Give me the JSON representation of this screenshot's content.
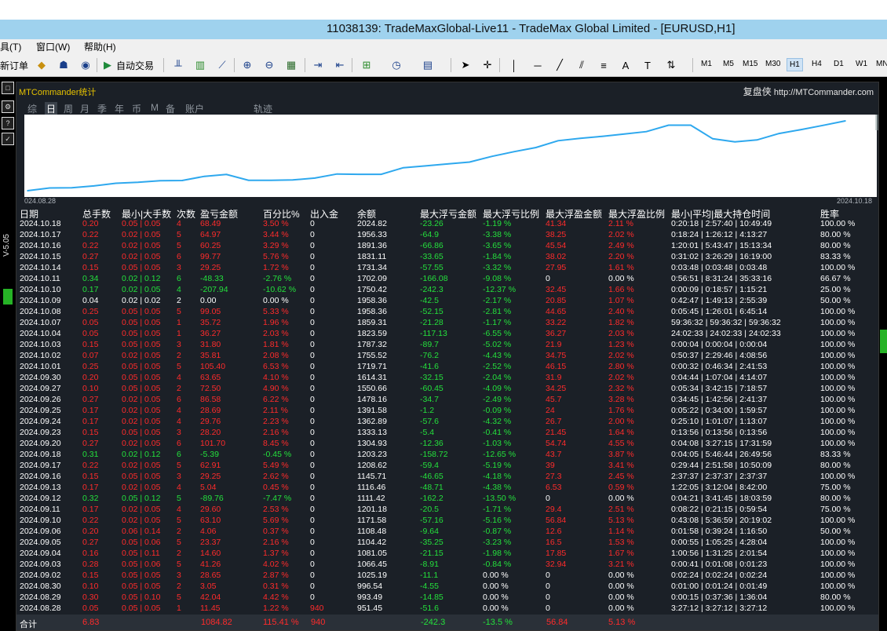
{
  "window": {
    "title": "11038139: TradeMaxGlobal-Live11 - TradeMax Global Limited - [EURUSD,H1]"
  },
  "menu": {
    "items": [
      "具(T)",
      "窗口(W)",
      "帮助(H)"
    ]
  },
  "toolbar": {
    "new_order": "新订单",
    "auto_trade": "自动交易",
    "timeframes": [
      "M1",
      "M5",
      "M15",
      "M30",
      "H1",
      "H4",
      "D1",
      "W1",
      "MN"
    ],
    "selected_timeframe": "H1"
  },
  "side": {
    "label": "V-5.05"
  },
  "panel": {
    "title": "MTCommander统计",
    "site_cn": "复盘侠",
    "site_url": "http://MTCommander.com",
    "tabs": [
      "综",
      "日",
      "周",
      "月",
      "季",
      "年",
      "币",
      "M",
      "备",
      "账户",
      "轨迹"
    ],
    "active_tab": "日",
    "chart_start": "024.08.28",
    "chart_end": "2024.10.18"
  },
  "chart_data": {
    "type": "line",
    "color": "#2ea8ee",
    "x": [
      "2024.08.28",
      "2024.08.29",
      "2024.08.30",
      "2024.09.02",
      "2024.09.03",
      "2024.09.04",
      "2024.09.05",
      "2024.09.06",
      "2024.09.09",
      "2024.09.10",
      "2024.09.11",
      "2024.09.12",
      "2024.09.13",
      "2024.09.16",
      "2024.09.17",
      "2024.09.18",
      "2024.09.19",
      "2024.09.20",
      "2024.09.23",
      "2024.09.24",
      "2024.09.25",
      "2024.09.26",
      "2024.09.27",
      "2024.09.30",
      "2024.10.01",
      "2024.10.02",
      "2024.10.03",
      "2024.10.04",
      "2024.10.07",
      "2024.10.08",
      "2024.10.09",
      "2024.10.10",
      "2024.10.11",
      "2024.10.14",
      "2024.10.15",
      "2024.10.16",
      "2024.10.17",
      "2024.10.18"
    ],
    "y": [
      951.45,
      993.49,
      996.54,
      1025.19,
      1066.45,
      1081.05,
      1104.42,
      1108.48,
      1171.58,
      1201.18,
      1111.42,
      1111.42,
      1116.46,
      1145.71,
      1208.62,
      1203.23,
      1203.23,
      1304.93,
      1333.13,
      1362.89,
      1391.58,
      1478.16,
      1550.66,
      1614.31,
      1719.71,
      1755.52,
      1787.32,
      1823.59,
      1859.31,
      1958.36,
      1958.36,
      1750.42,
      1702.09,
      1731.34,
      1831.11,
      1891.36,
      1956.33,
      2024.82
    ]
  },
  "table": {
    "headers": [
      "日期",
      "总手数",
      "最小|大手数",
      "次数",
      "盈亏金额",
      "百分比%",
      "出入金",
      "余额",
      "最大浮亏金额",
      "最大浮亏比例",
      "最大浮盈金额",
      "最大浮盈比例",
      "最小|平均|最大持仓时间",
      "胜率"
    ],
    "rows": [
      [
        "2024.10.18",
        "0.20",
        "0.05 | 0.05",
        "4",
        "68.49",
        "3.50 %",
        "0",
        "2024.82",
        "-23.26",
        "-1.19 %",
        "41.34",
        "2.11 %",
        "0:20:18 | 2:57:40 | 10:49:49",
        "100.00 %"
      ],
      [
        "2024.10.17",
        "0.22",
        "0.02 | 0.05",
        "5",
        "64.97",
        "3.44 %",
        "0",
        "1956.33",
        "-64.9",
        "-3.38 %",
        "38.25",
        "2.02 %",
        "0:18:24 | 1:26:12 | 4:13:27",
        "80.00 %"
      ],
      [
        "2024.10.16",
        "0.22",
        "0.02 | 0.05",
        "5",
        "60.25",
        "3.29 %",
        "0",
        "1891.36",
        "-66.86",
        "-3.65 %",
        "45.54",
        "2.49 %",
        "1:20:01 | 5:43:47 | 15:13:34",
        "80.00 %"
      ],
      [
        "2024.10.15",
        "0.27",
        "0.02 | 0.05",
        "6",
        "99.77",
        "5.76 %",
        "0",
        "1831.11",
        "-33.65",
        "-1.84 %",
        "38.02",
        "2.20 %",
        "0:31:02 | 3:26:29 | 16:19:00",
        "83.33 %"
      ],
      [
        "2024.10.14",
        "0.15",
        "0.05 | 0.05",
        "3",
        "29.25",
        "1.72 %",
        "0",
        "1731.34",
        "-57.55",
        "-3.32 %",
        "27.95",
        "1.61 %",
        "0:03:48 | 0:03:48 | 0:03:48",
        "100.00 %"
      ],
      [
        "2024.10.11",
        "0.34",
        "0.02 | 0.12",
        "6",
        "-48.33",
        "-2.76 %",
        "0",
        "1702.09",
        "-166.08",
        "-9.08 %",
        "0",
        "0.00 %",
        "0:56:51 | 8:31:24 | 35:33:16",
        "66.67 %"
      ],
      [
        "2024.10.10",
        "0.17",
        "0.02 | 0.05",
        "4",
        "-207.94",
        "-10.62 %",
        "0",
        "1750.42",
        "-242.3",
        "-12.37 %",
        "32.45",
        "1.66 %",
        "0:00:09 | 0:18:57 | 1:15:21",
        "25.00 %"
      ],
      [
        "2024.10.09",
        "0.04",
        "0.02 | 0.02",
        "2",
        "0.00",
        "0.00 %",
        "0",
        "1958.36",
        "-42.5",
        "-2.17 %",
        "20.85",
        "1.07 %",
        "0:42:47 | 1:49:13 | 2:55:39",
        "50.00 %"
      ],
      [
        "2024.10.08",
        "0.25",
        "0.05 | 0.05",
        "5",
        "99.05",
        "5.33 %",
        "0",
        "1958.36",
        "-52.15",
        "-2.81 %",
        "44.65",
        "2.40 %",
        "0:05:45 | 1:26:01 | 6:45:14",
        "100.00 %"
      ],
      [
        "2024.10.07",
        "0.05",
        "0.05 | 0.05",
        "1",
        "35.72",
        "1.96 %",
        "0",
        "1859.31",
        "-21.28",
        "-1.17 %",
        "33.22",
        "1.82 %",
        "59:36:32 | 59:36:32 | 59:36:32",
        "100.00 %"
      ],
      [
        "2024.10.04",
        "0.05",
        "0.05 | 0.05",
        "1",
        "36.27",
        "2.03 %",
        "0",
        "1823.59",
        "-117.13",
        "-6.55 %",
        "36.27",
        "2.03 %",
        "24:02:33 | 24:02:33 | 24:02:33",
        "100.00 %"
      ],
      [
        "2024.10.03",
        "0.15",
        "0.05 | 0.05",
        "3",
        "31.80",
        "1.81 %",
        "0",
        "1787.32",
        "-89.7",
        "-5.02 %",
        "21.9",
        "1.23 %",
        "0:00:04 | 0:00:04 | 0:00:04",
        "100.00 %"
      ],
      [
        "2024.10.02",
        "0.07",
        "0.02 | 0.05",
        "2",
        "35.81",
        "2.08 %",
        "0",
        "1755.52",
        "-76.2",
        "-4.43 %",
        "34.75",
        "2.02 %",
        "0:50:37 | 2:29:46 | 4:08:56",
        "100.00 %"
      ],
      [
        "2024.10.01",
        "0.25",
        "0.05 | 0.05",
        "5",
        "105.40",
        "6.53 %",
        "0",
        "1719.71",
        "-41.6",
        "-2.52 %",
        "46.15",
        "2.80 %",
        "0:00:32 | 0:46:34 | 2:41:53",
        "100.00 %"
      ],
      [
        "2024.09.30",
        "0.20",
        "0.05 | 0.05",
        "4",
        "63.65",
        "4.10 %",
        "0",
        "1614.31",
        "-32.15",
        "-2.04 %",
        "31.9",
        "2.02 %",
        "0:04:44 | 1:07:04 | 4:14:07",
        "100.00 %"
      ],
      [
        "2024.09.27",
        "0.10",
        "0.05 | 0.05",
        "2",
        "72.50",
        "4.90 %",
        "0",
        "1550.66",
        "-60.45",
        "-4.09 %",
        "34.25",
        "2.32 %",
        "0:05:34 | 3:42:15 | 7:18:57",
        "100.00 %"
      ],
      [
        "2024.09.26",
        "0.27",
        "0.02 | 0.05",
        "6",
        "86.58",
        "6.22 %",
        "0",
        "1478.16",
        "-34.7",
        "-2.49 %",
        "45.7",
        "3.28 %",
        "0:34:45 | 1:42:56 | 2:41:37",
        "100.00 %"
      ],
      [
        "2024.09.25",
        "0.17",
        "0.02 | 0.05",
        "4",
        "28.69",
        "2.11 %",
        "0",
        "1391.58",
        "-1.2",
        "-0.09 %",
        "24",
        "1.76 %",
        "0:05:22 | 0:34:00 | 1:59:57",
        "100.00 %"
      ],
      [
        "2024.09.24",
        "0.17",
        "0.02 | 0.05",
        "4",
        "29.76",
        "2.23 %",
        "0",
        "1362.89",
        "-57.6",
        "-4.32 %",
        "26.7",
        "2.00 %",
        "0:25:10 | 1:01:07 | 1:13:07",
        "100.00 %"
      ],
      [
        "2024.09.23",
        "0.15",
        "0.05 | 0.05",
        "3",
        "28.20",
        "2.16 %",
        "0",
        "1333.13",
        "-5.4",
        "-0.41 %",
        "21.45",
        "1.64 %",
        "0:13:56 | 0:13:56 | 0:13:56",
        "100.00 %"
      ],
      [
        "2024.09.20",
        "0.27",
        "0.02 | 0.05",
        "6",
        "101.70",
        "8.45 %",
        "0",
        "1304.93",
        "-12.36",
        "-1.03 %",
        "54.74",
        "4.55 %",
        "0:04:08 | 3:27:15 | 17:31:59",
        "100.00 %"
      ],
      [
        "2024.09.18",
        "0.31",
        "0.02 | 0.12",
        "6",
        "-5.39",
        "-0.45 %",
        "0",
        "1203.23",
        "-158.72",
        "-12.65 %",
        "43.7",
        "3.87 %",
        "0:04:05 | 5:46:44 | 26:49:56",
        "83.33 %"
      ],
      [
        "2024.09.17",
        "0.22",
        "0.02 | 0.05",
        "5",
        "62.91",
        "5.49 %",
        "0",
        "1208.62",
        "-59.4",
        "-5.19 %",
        "39",
        "3.41 %",
        "0:29:44 | 2:51:58 | 10:50:09",
        "80.00 %"
      ],
      [
        "2024.09.16",
        "0.15",
        "0.05 | 0.05",
        "3",
        "29.25",
        "2.62 %",
        "0",
        "1145.71",
        "-46.65",
        "-4.18 %",
        "27.3",
        "2.45 %",
        "2:37:37 | 2:37:37 | 2:37:37",
        "100.00 %"
      ],
      [
        "2024.09.13",
        "0.17",
        "0.02 | 0.05",
        "4",
        "5.04",
        "0.45 %",
        "0",
        "1116.46",
        "-48.71",
        "-4.38 %",
        "6.53",
        "0.59 %",
        "1:22:05 | 3:12:04 | 8:42:00",
        "75.00 %"
      ],
      [
        "2024.09.12",
        "0.32",
        "0.05 | 0.12",
        "5",
        "-89.76",
        "-7.47 %",
        "0",
        "1111.42",
        "-162.2",
        "-13.50 %",
        "0",
        "0.00 %",
        "0:04:21 | 3:41:45 | 18:03:59",
        "80.00 %"
      ],
      [
        "2024.09.11",
        "0.17",
        "0.02 | 0.05",
        "4",
        "29.60",
        "2.53 %",
        "0",
        "1201.18",
        "-20.5",
        "-1.71 %",
        "29.4",
        "2.51 %",
        "0:08:22 | 0:21:15 | 0:59:54",
        "75.00 %"
      ],
      [
        "2024.09.10",
        "0.22",
        "0.02 | 0.05",
        "5",
        "63.10",
        "5.69 %",
        "0",
        "1171.58",
        "-57.16",
        "-5.16 %",
        "56.84",
        "5.13 %",
        "0:43:08 | 5:36:59 | 20:19:02",
        "100.00 %"
      ],
      [
        "2024.09.06",
        "0.20",
        "0.06 | 0.14",
        "2",
        "4.06",
        "0.37 %",
        "0",
        "1108.48",
        "-9.64",
        "-0.87 %",
        "12.6",
        "1.14 %",
        "0:01:58 | 0:39:24 | 1:16:50",
        "50.00 %"
      ],
      [
        "2024.09.05",
        "0.27",
        "0.05 | 0.06",
        "5",
        "23.37",
        "2.16 %",
        "0",
        "1104.42",
        "-35.25",
        "-3.23 %",
        "16.5",
        "1.53 %",
        "0:00:55 | 1:05:25 | 4:28:04",
        "100.00 %"
      ],
      [
        "2024.09.04",
        "0.16",
        "0.05 | 0.11",
        "2",
        "14.60",
        "1.37 %",
        "0",
        "1081.05",
        "-21.15",
        "-1.98 %",
        "17.85",
        "1.67 %",
        "1:00:56 | 1:31:25 | 2:01:54",
        "100.00 %"
      ],
      [
        "2024.09.03",
        "0.28",
        "0.05 | 0.06",
        "5",
        "41.26",
        "4.02 %",
        "0",
        "1066.45",
        "-8.91",
        "-0.84 %",
        "32.94",
        "3.21 %",
        "0:00:41 | 0:01:08 | 0:01:23",
        "100.00 %"
      ],
      [
        "2024.09.02",
        "0.15",
        "0.05 | 0.05",
        "3",
        "28.65",
        "2.87 %",
        "0",
        "1025.19",
        "-11.1",
        "0.00 %",
        "0",
        "0.00 %",
        "0:02:24 | 0:02:24 | 0:02:24",
        "100.00 %"
      ],
      [
        "2024.08.30",
        "0.10",
        "0.05 | 0.05",
        "2",
        "3.05",
        "0.31 %",
        "0",
        "996.54",
        "-4.55",
        "0.00 %",
        "0",
        "0.00 %",
        "0:01:00 | 0:01:24 | 0:01:49",
        "100.00 %"
      ],
      [
        "2024.08.29",
        "0.30",
        "0.05 | 0.10",
        "5",
        "42.04",
        "4.42 %",
        "0",
        "993.49",
        "-14.85",
        "0.00 %",
        "0",
        "0.00 %",
        "0:00:15 | 0:37:36 | 1:36:04",
        "80.00 %"
      ],
      [
        "2024.08.28",
        "0.05",
        "0.05 | 0.05",
        "1",
        "11.45",
        "1.22 %",
        "940",
        "951.45",
        "-51.6",
        "0.00 %",
        "0",
        "0.00 %",
        "3:27:12 | 3:27:12 | 3:27:12",
        "100.00 %"
      ]
    ],
    "footer": {
      "label": "合计",
      "lots": "6.83",
      "pnl": "1084.82",
      "pct": "115.41 %",
      "deposit": "940",
      "maxloss": "-242.3",
      "maxloss_pct": "-13.5 %",
      "maxprofit": "56.84",
      "maxprofit_pct": "5.13 %"
    }
  }
}
